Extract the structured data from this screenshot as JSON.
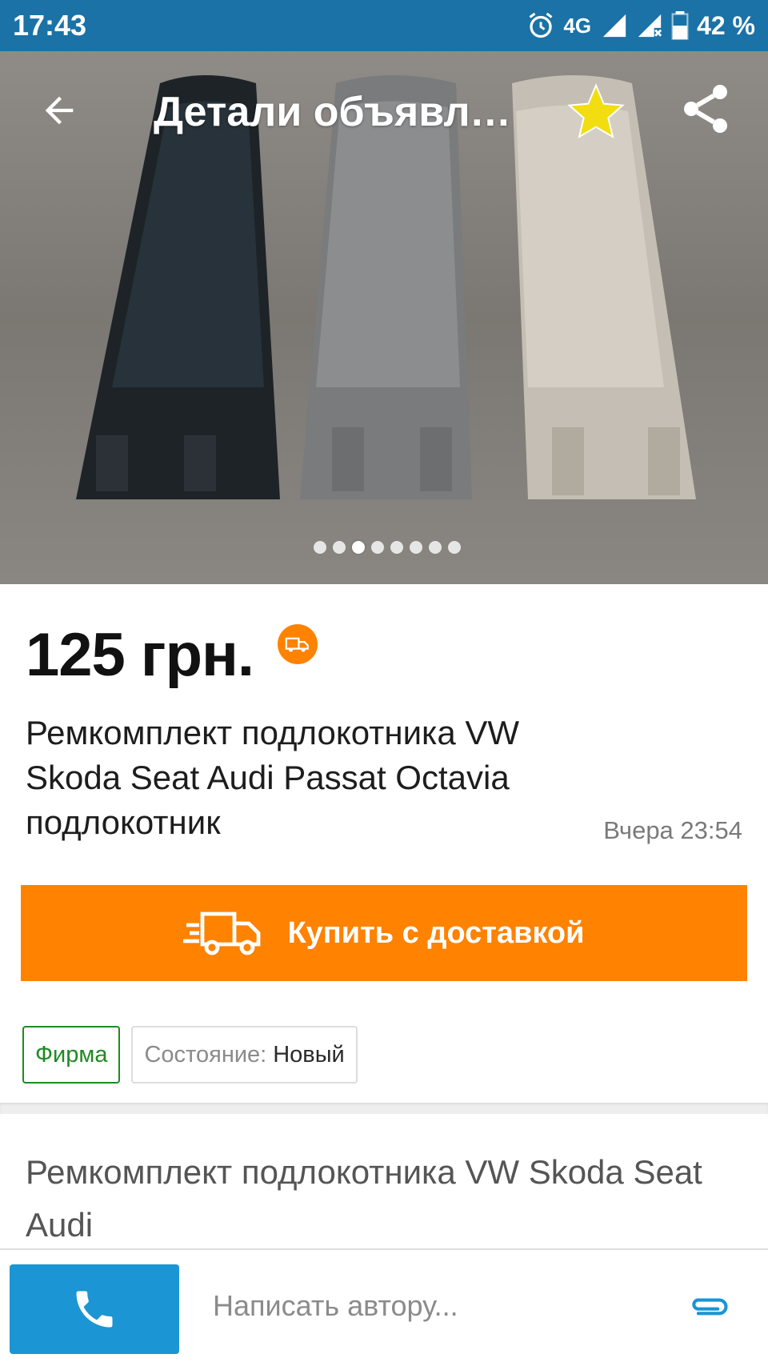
{
  "status_bar": {
    "time": "17:43",
    "network": "4G",
    "battery": "42 %"
  },
  "header": {
    "title": "Детали объявле…",
    "back_icon": "arrow-left-icon",
    "favorite_icon": "star-icon",
    "share_icon": "share-icon"
  },
  "gallery": {
    "photo_count": 8,
    "active_index": 2
  },
  "listing": {
    "price": "125 грн.",
    "delivery_badge_icon": "delivery-truck-icon",
    "title": "Ремкомплект подлокотника VW Skoda Seat Audi Passat Octavia подлокотник",
    "posted": "Вчера 23:54",
    "buy_label": "Купить с доставкой",
    "tags": {
      "seller_type": "Фирма",
      "condition_label": "Состояние:",
      "condition_value": "Новый"
    },
    "description": "Ремкомплект подлокотника VW Skoda Seat Audi"
  },
  "bottom_bar": {
    "call_icon": "phone-icon",
    "message_placeholder": "Написать автору...",
    "attach_icon": "paperclip-icon"
  },
  "colors": {
    "status_bar": "#1a72a6",
    "accent_orange": "#ff8200",
    "call_blue": "#1b95d3",
    "firm_green": "#1e8b23"
  }
}
